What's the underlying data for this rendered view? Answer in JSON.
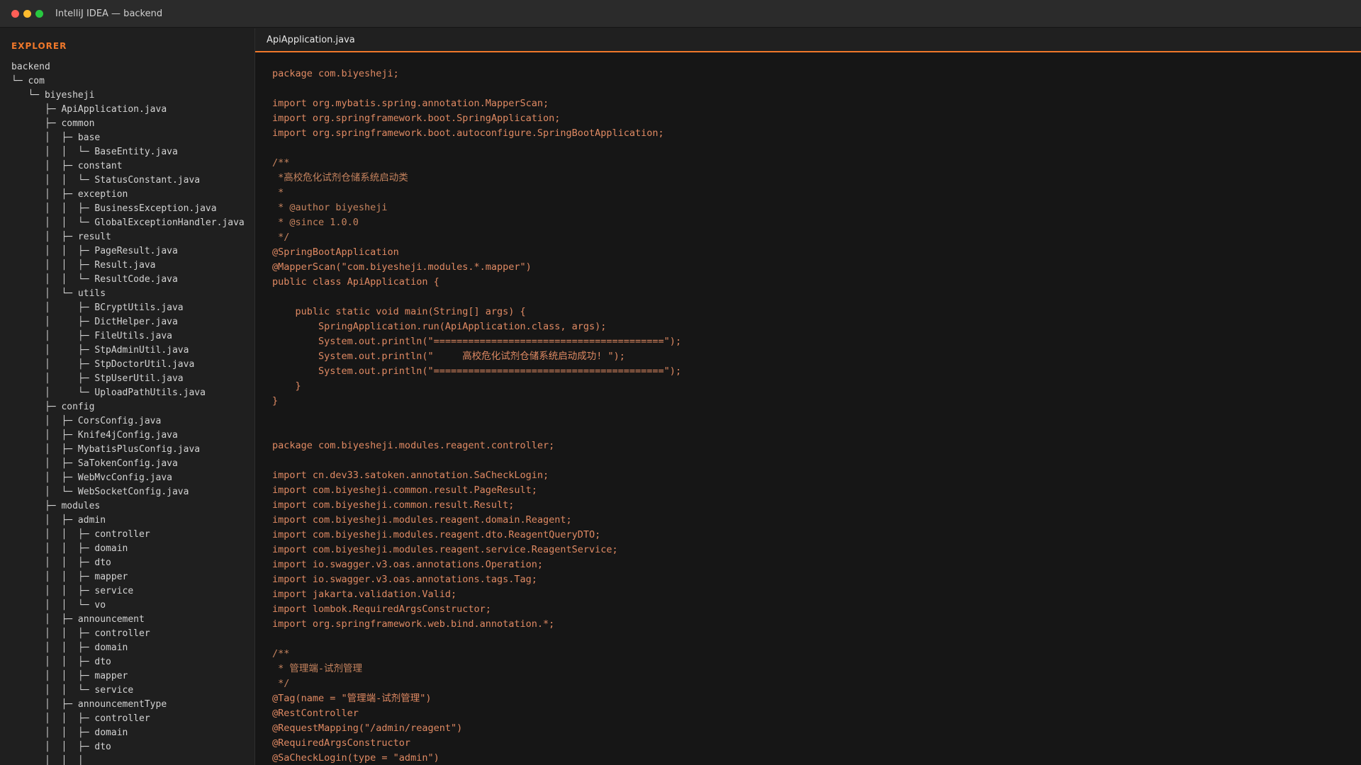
{
  "window": {
    "title": "IntelliJ IDEA — backend",
    "traffic_lights": [
      {
        "name": "close-button",
        "color": "#ff5f57"
      },
      {
        "name": "minimize-button",
        "color": "#febc2e"
      },
      {
        "name": "maximize-button",
        "color": "#28c840"
      }
    ]
  },
  "colors": {
    "accent": "#f0782a",
    "code_text": "#e08a63",
    "comment_text": "#c7845f"
  },
  "sidebar": {
    "label": "EXPLORER",
    "tree": [
      "backend",
      "└─ com",
      "   └─ biyesheji",
      "      ├─ ApiApplication.java",
      "      ├─ common",
      "      │  ├─ base",
      "      │  │  └─ BaseEntity.java",
      "      │  ├─ constant",
      "      │  │  └─ StatusConstant.java",
      "      │  ├─ exception",
      "      │  │  ├─ BusinessException.java",
      "      │  │  └─ GlobalExceptionHandler.java",
      "      │  ├─ result",
      "      │  │  ├─ PageResult.java",
      "      │  │  ├─ Result.java",
      "      │  │  └─ ResultCode.java",
      "      │  └─ utils",
      "      │     ├─ BCryptUtils.java",
      "      │     ├─ DictHelper.java",
      "      │     ├─ FileUtils.java",
      "      │     ├─ StpAdminUtil.java",
      "      │     ├─ StpDoctorUtil.java",
      "      │     ├─ StpUserUtil.java",
      "      │     └─ UploadPathUtils.java",
      "      ├─ config",
      "      │  ├─ CorsConfig.java",
      "      │  ├─ Knife4jConfig.java",
      "      │  ├─ MybatisPlusConfig.java",
      "      │  ├─ SaTokenConfig.java",
      "      │  ├─ WebMvcConfig.java",
      "      │  └─ WebSocketConfig.java",
      "      ├─ modules",
      "      │  ├─ admin",
      "      │  │  ├─ controller",
      "      │  │  ├─ domain",
      "      │  │  ├─ dto",
      "      │  │  ├─ mapper",
      "      │  │  ├─ service",
      "      │  │  └─ vo",
      "      │  ├─ announcement",
      "      │  │  ├─ controller",
      "      │  │  ├─ domain",
      "      │  │  ├─ dto",
      "      │  │  ├─ mapper",
      "      │  │  └─ service",
      "      │  ├─ announcementType",
      "      │  │  ├─ controller",
      "      │  │  ├─ domain",
      "      │  │  ├─ dto",
      "      │  │  │"
    ]
  },
  "editor": {
    "tab_label": "ApiApplication.java",
    "lines": [
      "package com.biyesheji;",
      "",
      "import org.mybatis.spring.annotation.MapperScan;",
      "import org.springframework.boot.SpringApplication;",
      "import org.springframework.boot.autoconfigure.SpringBootApplication;",
      "",
      "/**",
      " *高校危化试剂仓储系统启动类",
      " *",
      " * @author biyesheji",
      " * @since 1.0.0",
      " */",
      "@SpringBootApplication",
      "@MapperScan(\"com.biyesheji.modules.*.mapper\")",
      "public class ApiApplication {",
      "",
      "    public static void main(String[] args) {",
      "        SpringApplication.run(ApiApplication.class, args);",
      "        System.out.println(\"========================================\");",
      "        System.out.println(\"     高校危化试剂仓储系统启动成功! \");",
      "        System.out.println(\"========================================\");",
      "    }",
      "}",
      "",
      "",
      "package com.biyesheji.modules.reagent.controller;",
      "",
      "import cn.dev33.satoken.annotation.SaCheckLogin;",
      "import com.biyesheji.common.result.PageResult;",
      "import com.biyesheji.common.result.Result;",
      "import com.biyesheji.modules.reagent.domain.Reagent;",
      "import com.biyesheji.modules.reagent.dto.ReagentQueryDTO;",
      "import com.biyesheji.modules.reagent.service.ReagentService;",
      "import io.swagger.v3.oas.annotations.Operation;",
      "import io.swagger.v3.oas.annotations.tags.Tag;",
      "import jakarta.validation.Valid;",
      "import lombok.RequiredArgsConstructor;",
      "import org.springframework.web.bind.annotation.*;",
      "",
      "/**",
      " * 管理端-试剂管理",
      " */",
      "@Tag(name = \"管理端-试剂管理\")",
      "@RestController",
      "@RequestMapping(\"/admin/reagent\")",
      "@RequiredArgsConstructor",
      "@SaCheckLogin(type = \"admin\")"
    ]
  }
}
